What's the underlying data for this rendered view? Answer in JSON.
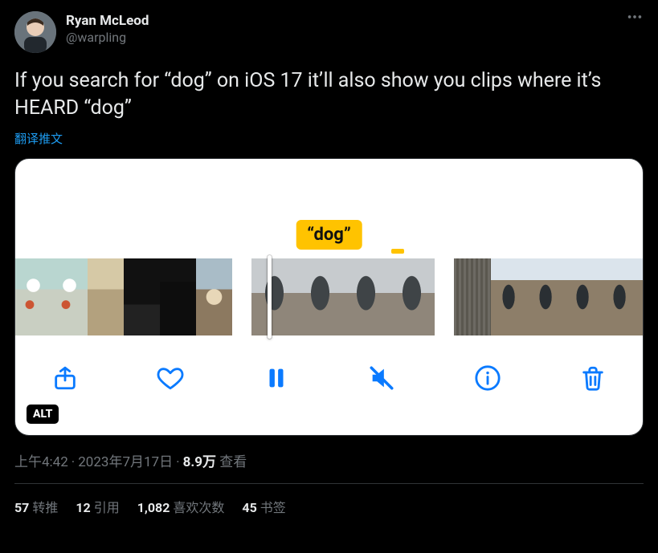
{
  "author": {
    "display_name": "Ryan McLeod",
    "handle": "@warpling"
  },
  "tweet_text": "If you search for “dog” on iOS 17 it’ll also show you clips where it’s HEARD “dog”",
  "translate_label": "翻译推文",
  "media": {
    "search_tooltip": "“dog”",
    "alt_badge": "ALT"
  },
  "meta": {
    "time": "上午4:42",
    "date": "2023年7月17日",
    "views_count": "8.9万",
    "views_label": "查看"
  },
  "stats": {
    "retweets": {
      "count": "57",
      "label": "转推"
    },
    "quotes": {
      "count": "12",
      "label": "引用"
    },
    "likes": {
      "count": "1,082",
      "label": "喜欢次数"
    },
    "bookmarks": {
      "count": "45",
      "label": "书签"
    }
  }
}
